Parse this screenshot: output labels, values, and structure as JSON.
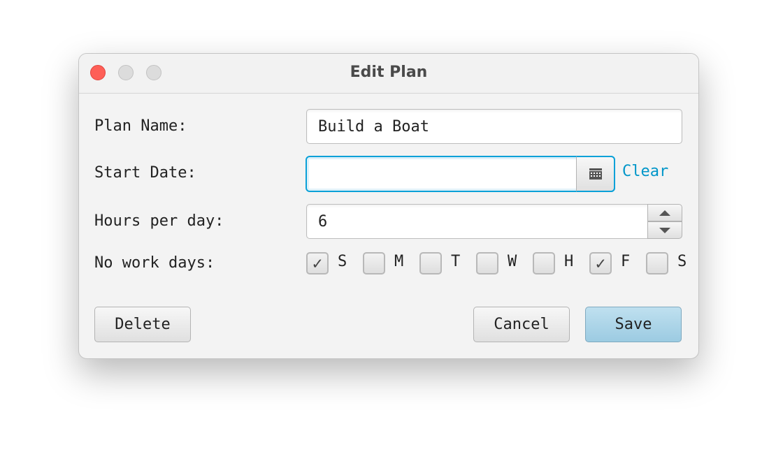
{
  "window": {
    "title": "Edit Plan",
    "close_color": "#fe5f57"
  },
  "form": {
    "plan_name_label": "Plan Name:",
    "plan_name_value": "Build a Boat",
    "start_date_label": "Start Date:",
    "start_date_value": "",
    "clear_label": "Clear",
    "hours_label": "Hours per day:",
    "hours_value": "6",
    "no_work_label": "No work days:",
    "days": [
      {
        "label": "S",
        "checked": true
      },
      {
        "label": "M",
        "checked": false
      },
      {
        "label": "T",
        "checked": false
      },
      {
        "label": "W",
        "checked": false
      },
      {
        "label": "H",
        "checked": false
      },
      {
        "label": "F",
        "checked": true
      },
      {
        "label": "S",
        "checked": false
      }
    ]
  },
  "buttons": {
    "delete": "Delete",
    "cancel": "Cancel",
    "save": "Save"
  },
  "colors": {
    "accent": "#0096c9",
    "save_bg": "#a9d4e8"
  }
}
